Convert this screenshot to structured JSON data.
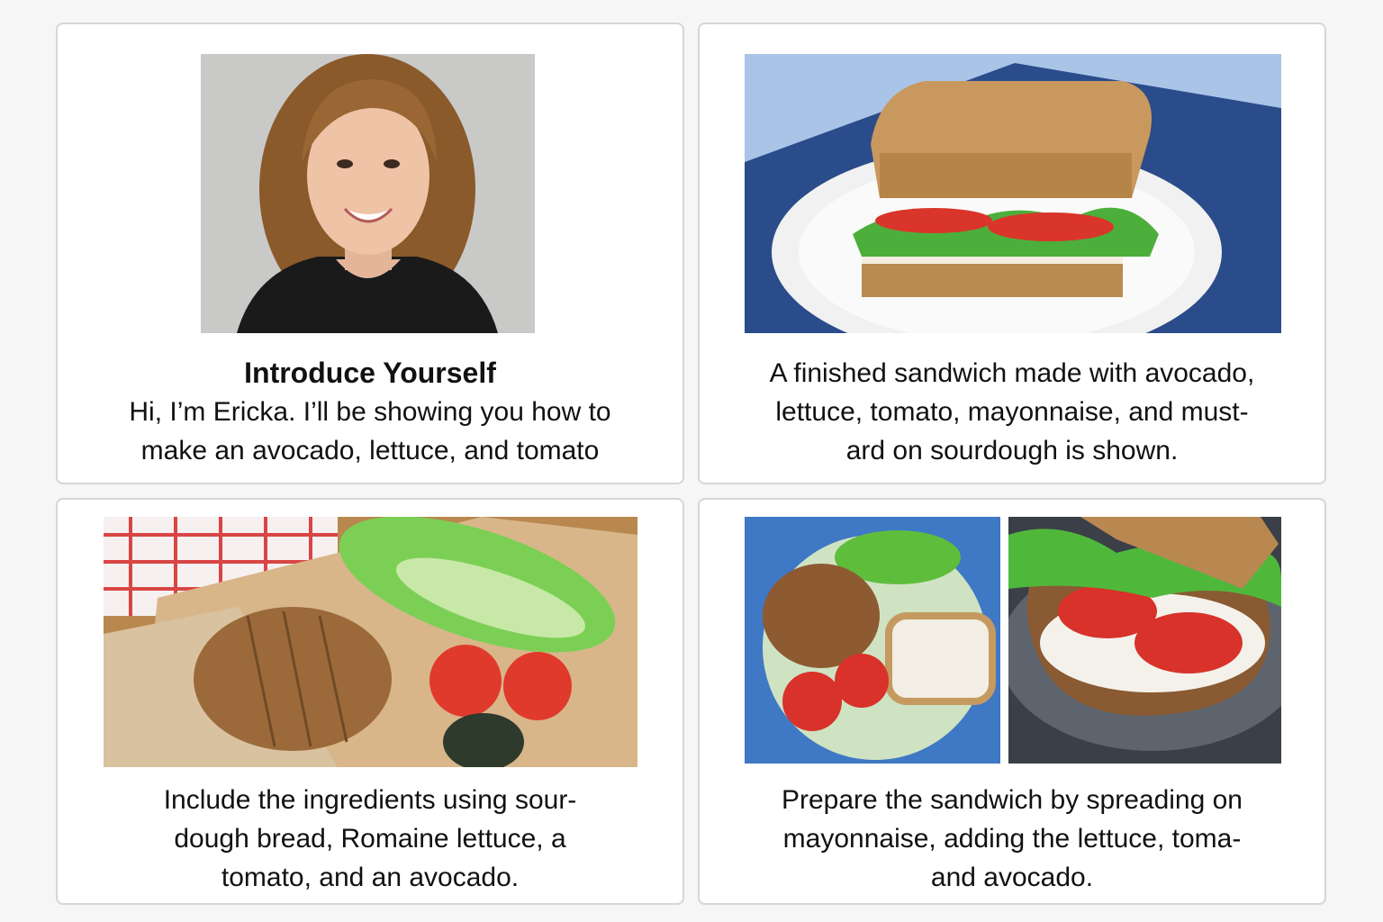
{
  "cards": [
    {
      "image_name": "portrait of Ericka",
      "title": "Introduce Yourself",
      "lines": [
        "Hi, I’m Ericka. I’ll be showing you how to",
        "make an avocado, lettuce, and tomato"
      ]
    },
    {
      "image_name": "finished sandwich on plate",
      "lines": [
        "A finished sandwich made with avocado,",
        "lettuce, tomato, mayonnaise, and must-",
        "ard on sourdough is shown."
      ]
    },
    {
      "image_name": "sandwich ingredients on cutting board",
      "lines": [
        "Include the ingredients using sour-",
        "dough bread, Romaine lettuce, a",
        "tomato, and an avocado."
      ]
    },
    {
      "image_name": "preparing the sandwich",
      "lines": [
        "Prepare the sandwich by spreading on",
        "mayonnaise, adding the lettuce, toma-",
        "and avocado."
      ]
    }
  ],
  "colors": {
    "page_background": "#f6f6f6",
    "card_border": "#d6d6d6",
    "text": "#111111"
  }
}
